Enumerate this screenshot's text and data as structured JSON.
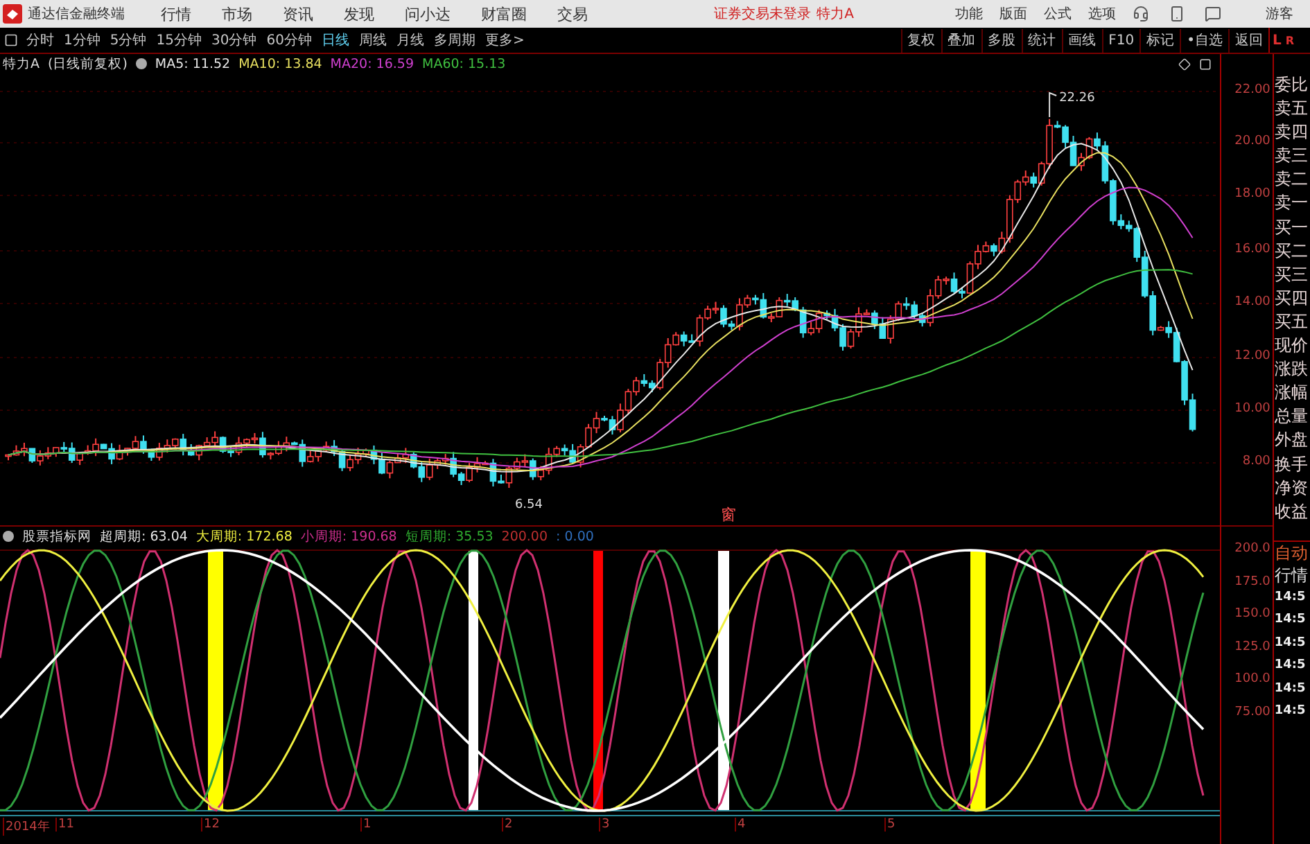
{
  "title_bar": {
    "app_name": "通达信金融终端",
    "menus": [
      "行情",
      "市场",
      "资讯",
      "发现",
      "问小达",
      "财富圈",
      "交易"
    ],
    "login_status": "证券交易未登录",
    "stock": "特力A",
    "right_menus": [
      "功能",
      "版面",
      "公式",
      "选项"
    ],
    "user": "游客"
  },
  "period_bar": {
    "periods": [
      {
        "label": "分时",
        "selected": false
      },
      {
        "label": "1分钟",
        "selected": false
      },
      {
        "label": "5分钟",
        "selected": false
      },
      {
        "label": "15分钟",
        "selected": false
      },
      {
        "label": "30分钟",
        "selected": false
      },
      {
        "label": "60分钟",
        "selected": false
      },
      {
        "label": "日线",
        "selected": true
      },
      {
        "label": "周线",
        "selected": false
      },
      {
        "label": "月线",
        "selected": false
      },
      {
        "label": "多周期",
        "selected": false
      },
      {
        "label": "更多>",
        "selected": false
      }
    ],
    "tools": [
      "复权",
      "叠加",
      "多股",
      "统计",
      "画线",
      "F10",
      "标记",
      "•自选",
      "返回"
    ]
  },
  "main_chart": {
    "stock_title": "特力A",
    "adjust": "(日线前复权)",
    "indicators": [
      {
        "text": "MA5: 11.52",
        "color": "#e8e8e8"
      },
      {
        "text": "MA10: 13.84",
        "color": "#e8e060"
      },
      {
        "text": "MA20: 16.59",
        "color": "#d040d0"
      },
      {
        "text": "MA60: 15.13",
        "color": "#40c040"
      }
    ],
    "high_label": "22.26",
    "low_label": "6.54",
    "marker": "窗",
    "y_axis": [
      "22.00",
      "20.00",
      "18.00",
      "16.00",
      "14.00",
      "12.00",
      "10.00",
      "8.00"
    ]
  },
  "indicator_panel": {
    "name": "股票指标网",
    "items": [
      {
        "text": "超周期: 63.04",
        "color": "#e8e8e8"
      },
      {
        "text": "大周期: 172.68",
        "color": "#f0f040"
      },
      {
        "text": "小周期: 190.68",
        "color": "#d03090"
      },
      {
        "text": "短周期: 35.53",
        "color": "#30b030"
      },
      {
        "text": "200.00",
        "color": "#c03030"
      },
      {
        "text": ": 0.00",
        "color": "#3070c0"
      }
    ],
    "y_axis": [
      "200.0",
      "175.0",
      "150.0",
      "125.0",
      "100.0",
      "75.00"
    ]
  },
  "x_axis": [
    "2014年",
    "11",
    "12",
    "1",
    "2",
    "3",
    "4",
    "5"
  ],
  "side_panel": {
    "header": [
      "L",
      "R"
    ],
    "quote_labels": [
      "委比",
      "卖五",
      "卖四",
      "卖三",
      "卖二",
      "卖一",
      "买一",
      "买二",
      "买三",
      "买四",
      "买五",
      "现价",
      "涨跌",
      "涨幅",
      "总量",
      "外盘",
      "换手",
      "净资",
      "收益"
    ],
    "auto_labels": [
      "自动",
      "行情"
    ],
    "times": [
      "14:5",
      "14:5",
      "14:5",
      "14:5",
      "14:5",
      "14:5"
    ]
  }
}
